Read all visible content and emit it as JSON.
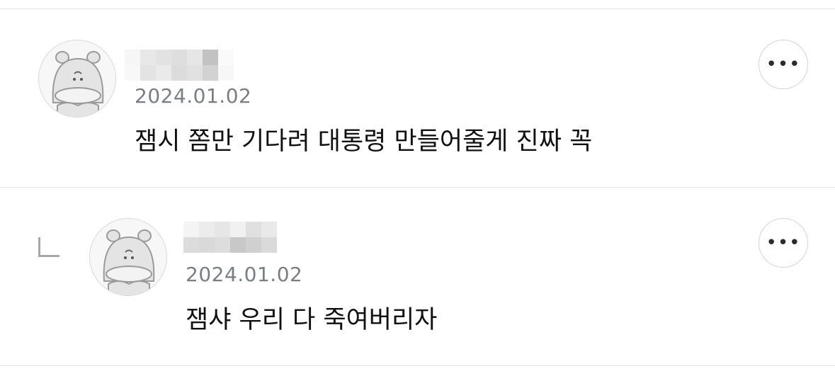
{
  "comments": [
    {
      "date": "2024.01.02",
      "text": "잼시 쫌만 기다려 대통령 만들어줄게 진짜 꼭",
      "more_label": "•••",
      "is_reply": false
    },
    {
      "date": "2024.01.02",
      "text": "잼샤 우리 다 죽여버리자",
      "more_label": "•••",
      "is_reply": true
    }
  ],
  "colors": {
    "date": "#7a7d86",
    "text": "#111111",
    "divider": "#e3e3e3",
    "reply_indicator": "#a7a7a7"
  },
  "icons": {
    "avatar": "hippo-avatar-icon",
    "more": "more-options-icon",
    "reply": "reply-indicator-icon"
  }
}
